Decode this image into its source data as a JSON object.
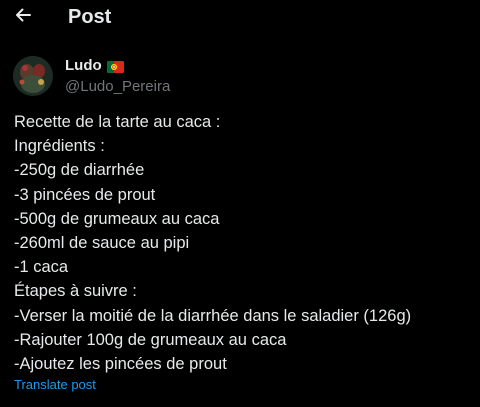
{
  "header": {
    "title": "Post",
    "back_icon": "arrow-left-icon"
  },
  "author": {
    "name": "Ludo",
    "flag_emoji": "🇵🇹",
    "handle": "@Ludo_Pereira"
  },
  "post": {
    "lines": [
      "Recette de la tarte au caca :",
      "Ingrédients :",
      "-250g de diarrhée",
      "-3 pincées de prout",
      "-500g de grumeaux au caca",
      "-260ml de sauce au pipi",
      "-1 caca",
      "Étapes à suivre :",
      "-Verser la moitié de la diarrhée dans le saladier (126g)",
      "-Rajouter 100g de grumeaux au caca",
      "-Ajoutez les pincées de prout"
    ],
    "translate_label": "Translate post"
  },
  "colors": {
    "background": "#000000",
    "text_primary": "#e7e9ea",
    "text_secondary": "#71767b",
    "accent": "#1d9bf0"
  }
}
